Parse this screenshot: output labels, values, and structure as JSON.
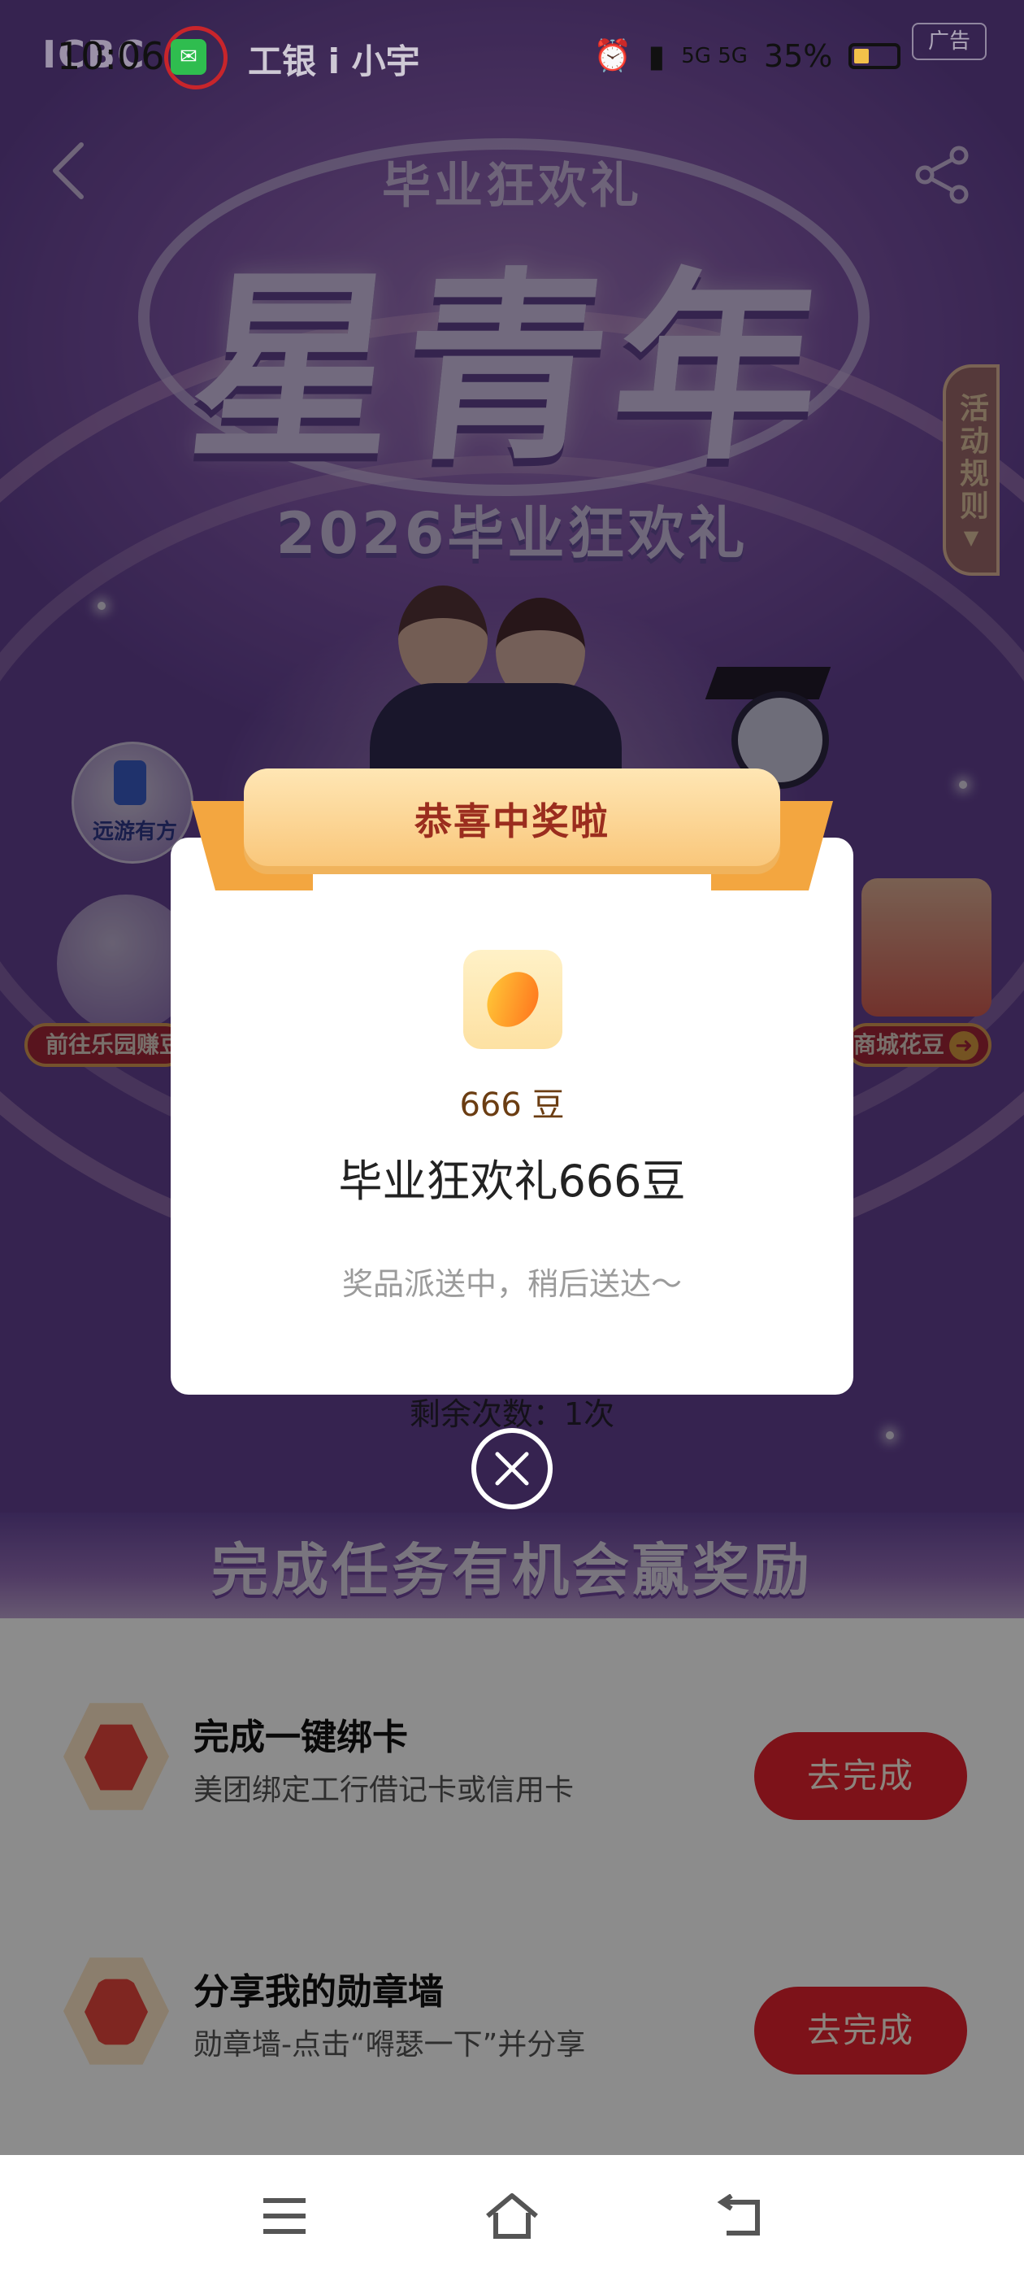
{
  "status_bar": {
    "time": "10:06",
    "logo_text": "ICBC",
    "brand_text": "工银 i 小宇",
    "network": "5G 5G",
    "battery": "35%",
    "ad_label": "广告"
  },
  "hero": {
    "title_small": "毕业狂欢礼",
    "title_big": "星青年",
    "subtitle": "2026毕业狂欢礼",
    "rules_tab": "活动规则",
    "rules_arrow": "▼",
    "travel_label": "远游有方",
    "left_entry_label": "前往乐园赚豆",
    "right_entry_label": "商城花豆",
    "remaining_label": "剩余次数：",
    "remaining_count": "1次"
  },
  "modal": {
    "ribbon_text": "恭喜中奖啦",
    "prize_amount": "666 豆",
    "prize_name": "毕业狂欢礼666豆",
    "prize_note": "奖品派送中，稍后送达～",
    "close_icon": "close-icon"
  },
  "task_section": {
    "banner": "完成任务有机会赢奖励",
    "tasks": [
      {
        "title": "完成一键绑卡",
        "desc": "美团绑定工行借记卡或信用卡",
        "button": "去完成",
        "icon": "clipboard-icon"
      },
      {
        "title": "分享我的勋章墙",
        "desc": "勋章墙-点击“嘚瑟一下”并分享",
        "button": "去完成",
        "icon": "magnifier-icon"
      }
    ]
  },
  "colors": {
    "accent_red": "#e3212e",
    "ribbon_gold": "#f9c77b",
    "hero_purple": "#8f63b6"
  }
}
